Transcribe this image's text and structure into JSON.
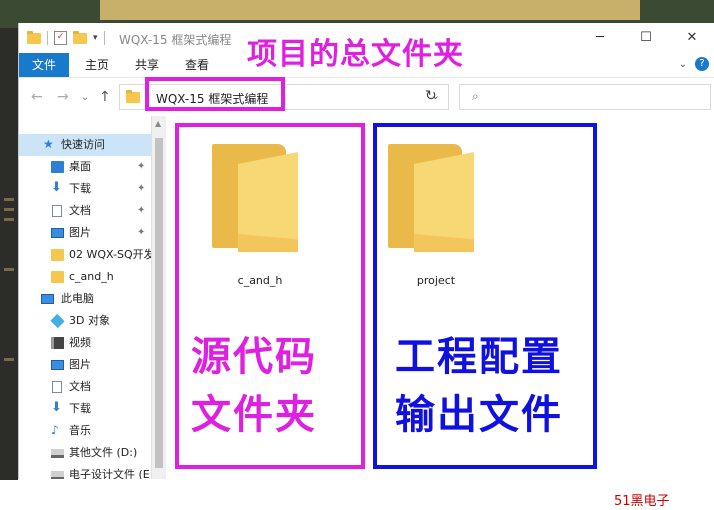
{
  "window": {
    "title": "WQX-15 框架式编程",
    "controls": {
      "minimize": "─",
      "maximize": "☐",
      "close": "✕"
    }
  },
  "annotations": {
    "top_title": "项目的总文件夹",
    "left_box": [
      "源代码",
      "文件夹"
    ],
    "right_box": [
      "工程配置",
      "输出文件"
    ],
    "colors": {
      "magenta": "#e020e0",
      "blue": "#1010e0"
    }
  },
  "ribbon": {
    "tabs": [
      "文件",
      "主页",
      "共享",
      "查看"
    ]
  },
  "address": {
    "path": "WQX-15 框架式编程",
    "search_placeholder": ""
  },
  "sidebar": {
    "items": [
      {
        "label": "快速访问",
        "icon": "star-icon",
        "pinned": false
      },
      {
        "label": "桌面",
        "icon": "desktop-icon",
        "pinned": true
      },
      {
        "label": "下载",
        "icon": "download-icon",
        "pinned": true
      },
      {
        "label": "文档",
        "icon": "document-icon",
        "pinned": true
      },
      {
        "label": "图片",
        "icon": "picture-icon",
        "pinned": true
      },
      {
        "label": "02 WQX-SQ开发",
        "icon": "folder-icon",
        "pinned": false
      },
      {
        "label": "c_and_h",
        "icon": "folder-icon",
        "pinned": false
      },
      {
        "label": "此电脑",
        "icon": "computer-icon",
        "pinned": false
      },
      {
        "label": "3D 对象",
        "icon": "cube-icon",
        "pinned": false
      },
      {
        "label": "视频",
        "icon": "video-icon",
        "pinned": false
      },
      {
        "label": "图片",
        "icon": "picture-icon",
        "pinned": false
      },
      {
        "label": "文档",
        "icon": "document-icon",
        "pinned": false
      },
      {
        "label": "下载",
        "icon": "download-icon",
        "pinned": false
      },
      {
        "label": "音乐",
        "icon": "music-icon",
        "pinned": false
      },
      {
        "label": "其他文件 (D:)",
        "icon": "drive-icon",
        "pinned": false
      },
      {
        "label": "电子设计文件 (E",
        "icon": "drive-icon",
        "pinned": false
      }
    ]
  },
  "files": [
    {
      "name": "c_and_h",
      "icon": "folder-icon"
    },
    {
      "name": "project",
      "icon": "folder-icon"
    }
  ],
  "watermark": "51黑电子"
}
